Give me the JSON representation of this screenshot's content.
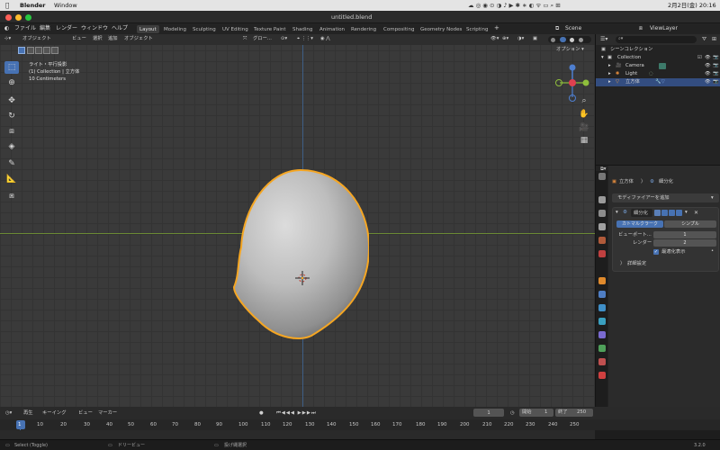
{
  "macos": {
    "app_name": "Blender",
    "menu": [
      "Window"
    ],
    "clock": "2月2日(金)  20:16"
  },
  "window": {
    "title": "untitled.blend"
  },
  "menubar": {
    "items": [
      "ファイル",
      "編集",
      "レンダー",
      "ウィンドウ",
      "ヘルプ"
    ],
    "workspaces": [
      "Layout",
      "Modeling",
      "Sculpting",
      "UV Editing",
      "Texture Paint",
      "Shading",
      "Animation",
      "Rendering",
      "Compositing",
      "Geometry Nodes",
      "Scripting"
    ],
    "active_workspace": "Layout",
    "scene_label": "Scene",
    "viewlayer_label": "ViewLayer"
  },
  "viewport_header": {
    "mode": "オブジェクト",
    "menus": [
      "ビュー",
      "選択",
      "追加",
      "オブジェクト"
    ],
    "transform": "グロー...",
    "options": "オプション"
  },
  "viewport_info": {
    "line1": "ライト・平行投影",
    "line2": "(1) Collection | 立方体",
    "line3": "10 Centimeters"
  },
  "gizmo": {
    "x": "X",
    "y": "Y",
    "z": "Z"
  },
  "outliner": {
    "root": "シーンコレクション",
    "collection": "Collection",
    "items": [
      {
        "name": "Camera"
      },
      {
        "name": "Light"
      },
      {
        "name": "立方体",
        "selected": true
      }
    ]
  },
  "properties": {
    "breadcrumb_object": "立方体",
    "breadcrumb_modifier": "細分化",
    "add_modifier": "モディファイアーを追加",
    "modifier_name": "細分化",
    "mode_catmull": "カトマルクラーク",
    "mode_simple": "シンプル",
    "viewport_label": "ビューポート...",
    "viewport_value": "1",
    "render_label": "レンダー",
    "render_value": "2",
    "optimal_display": "最適化表示",
    "optimal_display_checked": true,
    "advanced": "詳細設定"
  },
  "timeline": {
    "menus": [
      "再生",
      "キーイング",
      "ビュー",
      "マーカー"
    ],
    "current_frame": "1",
    "start_label": "開始",
    "start_value": "1",
    "end_label": "終了",
    "end_value": "250",
    "ticks": [
      "1",
      "10",
      "20",
      "30",
      "40",
      "50",
      "60",
      "70",
      "80",
      "90",
      "100",
      "110",
      "120",
      "130",
      "140",
      "150",
      "160",
      "170",
      "180",
      "190",
      "200",
      "210",
      "220",
      "230",
      "240",
      "250"
    ]
  },
  "statusbar": {
    "left": "Select (Toggle)",
    "middle": "ドリービュー",
    "right": "投げ縄選択",
    "version": "3.2.0"
  },
  "colors": {
    "accent": "#4772b3",
    "selection_outline": "#f5a623",
    "x_axis": "#6b8a35",
    "z_axis": "#3f5f86"
  }
}
